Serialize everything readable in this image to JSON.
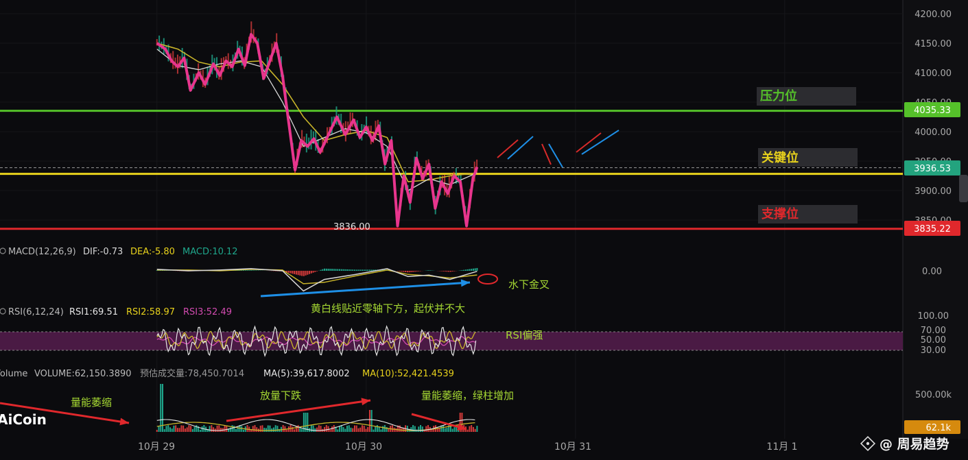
{
  "colors": {
    "background": "#0b0b0e",
    "axis_bg": "#111114",
    "price_line": "#e8358d",
    "ma_yellow": "#c9b52a",
    "ma_white": "#d8d8d8",
    "resistance": "#55c02a",
    "key": "#e8d21c",
    "support": "#e0282c",
    "rsi_band": "#4a1a44",
    "hist_green": "#1fa78c",
    "hist_red": "#d43a3a",
    "arrow_blue": "#1e8fe6",
    "arrow_red": "#e0282c",
    "annotation_green": "#a6d933",
    "volume_badge": "#d68a0e",
    "key_badge": "#23a37e"
  },
  "chart_data": [
    {
      "type": "line",
      "panel": "price",
      "y_ticks": [
        "4200.00",
        "4150.00",
        "4100.00",
        "4050.00",
        "4000.00",
        "3950.00",
        "3900.00",
        "3850.00"
      ],
      "ylim": [
        3830,
        4215
      ],
      "x_labels": [
        "10月 29",
        "10月 30",
        "10月 31",
        "11月 1"
      ],
      "series": [
        {
          "role": "price",
          "t": [
            0,
            0.04,
            0.07,
            0.1,
            0.13,
            0.16,
            0.2,
            0.23,
            0.27,
            0.3,
            0.33,
            0.36,
            0.39,
            0.42,
            0.45,
            0.48,
            0.51,
            0.54,
            0.57,
            0.6,
            0.63,
            0.66,
            0.69,
            0.72,
            0.75,
            0.78,
            0.82,
            0.86,
            0.9,
            0.94,
            0.97,
            1.0,
            1.03,
            1.06,
            1.09,
            1.12,
            1.15,
            1.18,
            1.21,
            1.24,
            1.27,
            1.3,
            1.33,
            1.36,
            1.39,
            1.42,
            1.45,
            1.48,
            1.51,
            1.53
          ],
          "values": [
            4150,
            4140,
            4120,
            4110,
            4125,
            4070,
            4100,
            4080,
            4115,
            4095,
            4120,
            4110,
            4140,
            4112,
            4165,
            4150,
            4090,
            4120,
            4150,
            4095,
            4015,
            3935,
            3985,
            3975,
            3988,
            3965,
            3995,
            4025,
            3995,
            4020,
            3990,
            4008,
            3985,
            4010,
            3945,
            3985,
            3840,
            3925,
            3880,
            3955,
            3920,
            3945,
            3870,
            3915,
            3895,
            3925,
            3915,
            3840,
            3920,
            3940
          ]
        },
        {
          "role": "ma_yellow",
          "t": [
            0,
            0.1,
            0.2,
            0.3,
            0.4,
            0.5,
            0.6,
            0.7,
            0.8,
            0.9,
            1.0,
            1.1,
            1.2,
            1.3,
            1.4,
            1.53
          ],
          "values": [
            4150,
            4140,
            4118,
            4110,
            4118,
            4120,
            4080,
            4025,
            3985,
            3995,
            4002,
            3990,
            3915,
            3918,
            3925,
            3930
          ]
        },
        {
          "role": "ma_white",
          "t": [
            0,
            0.1,
            0.2,
            0.3,
            0.4,
            0.5,
            0.6,
            0.7,
            0.8,
            0.9,
            1.0,
            1.1,
            1.2,
            1.3,
            1.4,
            1.53
          ],
          "values": [
            4140,
            4112,
            4105,
            4115,
            4120,
            4110,
            4050,
            3975,
            3990,
            4005,
            3998,
            3975,
            3900,
            3920,
            3910,
            3930
          ]
        }
      ],
      "levels": [
        {
          "name": "压力位",
          "value": 4035.33,
          "label": "4035.33"
        },
        {
          "name": "关键位",
          "value": 3936.53,
          "label": "3936.53"
        },
        {
          "name": "支撑位",
          "value": 3835.22,
          "label": "3835.22"
        }
      ],
      "low_marker": "3836.00"
    },
    {
      "type": "line",
      "panel": "macd",
      "header": {
        "name": "MACD(12,26,9)",
        "dif": "DIF:-0.73",
        "dea": "DEA:-5.80",
        "macd": "MACD:10.12"
      },
      "y_ticks": [
        "0.00"
      ],
      "ylim": [
        -40,
        20
      ],
      "series": [
        {
          "role": "dif",
          "t": [
            0,
            0.15,
            0.3,
            0.45,
            0.6,
            0.7,
            0.8,
            0.95,
            1.1,
            1.2,
            1.3,
            1.4,
            1.53
          ],
          "values": [
            2,
            0,
            1,
            3,
            0,
            -28,
            -12,
            -5,
            3,
            -8,
            -6,
            -12,
            -0.73
          ]
        },
        {
          "role": "dea",
          "t": [
            0,
            0.15,
            0.3,
            0.45,
            0.6,
            0.7,
            0.8,
            0.95,
            1.1,
            1.2,
            1.3,
            1.4,
            1.53
          ],
          "values": [
            1,
            1,
            0,
            2,
            1,
            -18,
            -16,
            -7,
            1,
            -5,
            -7,
            -10,
            -5.8
          ]
        }
      ]
    },
    {
      "type": "line",
      "panel": "rsi",
      "header": {
        "name": "RSI(6,12,24)",
        "rsi1": "RSI1:69.51",
        "rsi2": "RSI2:58.97",
        "rsi3": "RSI3:52.49"
      },
      "y_ticks": [
        "100.00",
        "70.00",
        "50.00",
        "30.00"
      ],
      "ylim": [
        0,
        100
      ]
    },
    {
      "type": "bar",
      "panel": "volume",
      "header": {
        "name": "Volume",
        "volume": "VOLUME:62,150.3890",
        "estimate": "预估成交量:78,450.7014",
        "ma5": "MA(5):39,617.8002",
        "ma10": "MA(10):52,421.4539"
      },
      "y_ticks": [
        "500.00k"
      ],
      "current": "62.1k"
    }
  ],
  "annotations": {
    "resistance": "压力位",
    "key": "关键位",
    "support": "支撑位",
    "golden_cross": "水下金叉",
    "macd_note": "黄白线贴近零轴下方，起伏并不大",
    "rsi_note": "RSI偏强",
    "vol_note1": "量能萎缩",
    "vol_note2": "放量下跌",
    "vol_note3": "量能萎缩，绿柱增加"
  },
  "branding": {
    "logo": "AiCoin",
    "watermark": "@ 周易趋势"
  }
}
